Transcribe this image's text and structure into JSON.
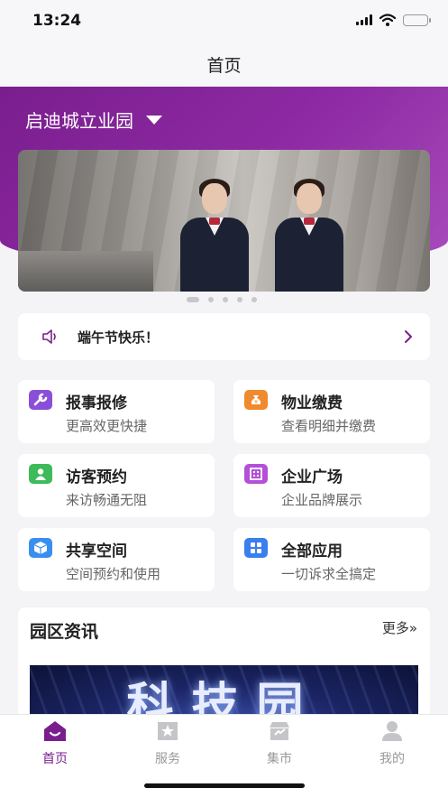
{
  "status_bar": {
    "time": "13:24"
  },
  "nav": {
    "title": "首页"
  },
  "park": {
    "name": "启迪城立业园"
  },
  "banner": {
    "dots": 5,
    "active_index": 0
  },
  "notice": {
    "text": "端午节快乐！"
  },
  "tiles": [
    {
      "title": "报事报修",
      "subtitle": "更高效更快捷",
      "icon": "wrench-icon",
      "color": "#8a4fd8"
    },
    {
      "title": "物业缴费",
      "subtitle": "查看明细并缴费",
      "icon": "money-bag-icon",
      "color": "#f08a2e"
    },
    {
      "title": "访客预约",
      "subtitle": "来访畅通无阻",
      "icon": "visitor-icon",
      "color": "#3dbb5a"
    },
    {
      "title": "企业广场",
      "subtitle": "企业品牌展示",
      "icon": "building-icon",
      "color": "#b44fd8"
    },
    {
      "title": "共享空间",
      "subtitle": "空间预约和使用",
      "icon": "cube-icon",
      "color": "#3a8ef0"
    },
    {
      "title": "全部应用",
      "subtitle": "一切诉求全搞定",
      "icon": "grid-icon",
      "color": "#3a7ef0"
    }
  ],
  "news": {
    "title": "园区资讯",
    "more": "更多»",
    "image_text": "科技园"
  },
  "tabs": [
    {
      "label": "首页",
      "icon": "home-icon",
      "active": true
    },
    {
      "label": "服务",
      "icon": "star-bookmark-icon",
      "active": false
    },
    {
      "label": "集市",
      "icon": "market-icon",
      "active": false
    },
    {
      "label": "我的",
      "icon": "user-icon",
      "active": false
    }
  ],
  "colors": {
    "brand": "#7a1e8e",
    "inactive": "#c5c5c9"
  }
}
